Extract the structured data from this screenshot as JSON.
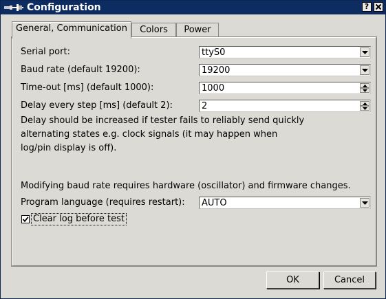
{
  "window": {
    "title": "Configuration",
    "help_label": "?",
    "close_label": "X"
  },
  "tabs": [
    {
      "label": "General, Communication",
      "active": true
    },
    {
      "label": "Colors",
      "active": false
    },
    {
      "label": "Power",
      "active": false
    }
  ],
  "form": {
    "serial_port": {
      "label": "Serial port:",
      "value": "ttyS0"
    },
    "baud_rate": {
      "label": "Baud rate (default 19200):",
      "value": "19200"
    },
    "timeout": {
      "label": "Time-out [ms] (default 1000):",
      "value": "1000"
    },
    "delay": {
      "label": "Delay every step [ms] (default 2):",
      "value": "2"
    },
    "delay_note_lines": [
      "Delay should be increased if tester fails to reliably send quickly",
      "alternating states e.g. clock signals (it may happen when",
      "log/pin display is off)."
    ],
    "baud_note": "Modifying baud rate requires hardware (oscillator) and firmware changes.",
    "language": {
      "label": "Program language (requires restart):",
      "value": "AUTO"
    },
    "clear_log": {
      "label": "Clear log before test",
      "checked": true
    }
  },
  "buttons": {
    "ok": "OK",
    "cancel": "Cancel"
  },
  "colors": {
    "titlebar": "#0d2c61",
    "background": "#dcdad5"
  }
}
